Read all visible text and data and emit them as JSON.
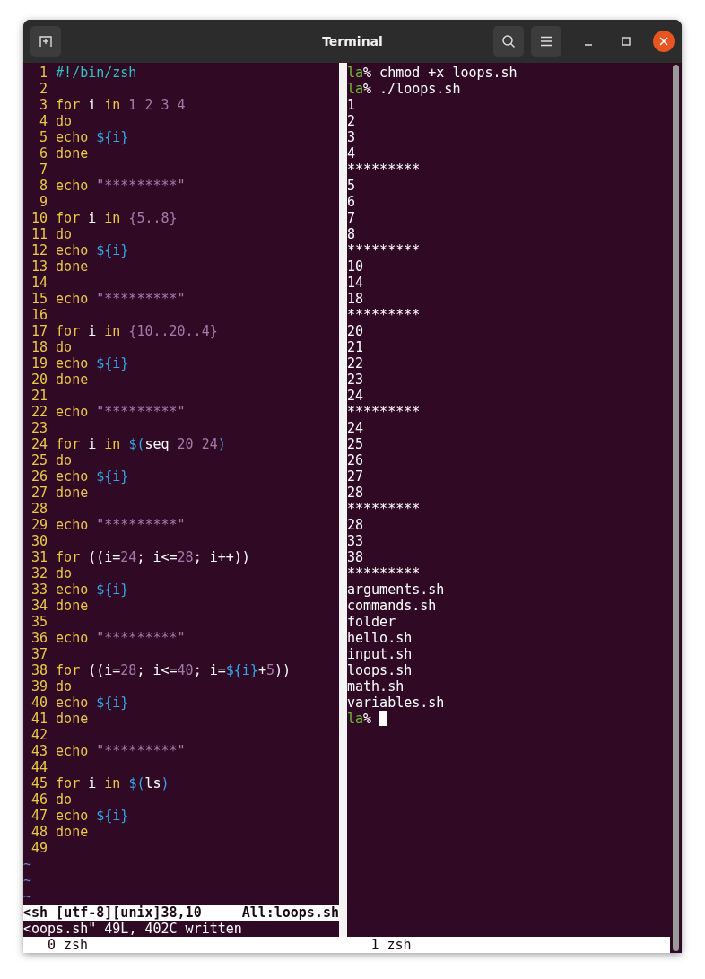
{
  "window": {
    "title": "Terminal"
  },
  "editor": {
    "lines": [
      {
        "number": "1",
        "tokens": [
          {
            "kind": "shebang",
            "text": "#!/bin/zsh"
          }
        ]
      },
      {
        "number": "2"
      },
      {
        "number": "3",
        "tokens": [
          {
            "kind": "keyword",
            "text": "for"
          },
          {
            "kind": "plain",
            "text": " i "
          },
          {
            "kind": "keyword",
            "text": "in"
          },
          {
            "kind": "number",
            "text": " 1 2 3 4"
          }
        ]
      },
      {
        "number": "4",
        "tokens": [
          {
            "kind": "keyword",
            "text": "do"
          }
        ]
      },
      {
        "number": "5",
        "tokens": [
          {
            "kind": "keyword",
            "text": "echo "
          },
          {
            "kind": "variable",
            "text": "${i}"
          }
        ]
      },
      {
        "number": "6",
        "tokens": [
          {
            "kind": "keyword",
            "text": "done"
          }
        ]
      },
      {
        "number": "7"
      },
      {
        "number": "8",
        "tokens": [
          {
            "kind": "keyword",
            "text": "echo "
          },
          {
            "kind": "string",
            "text": "\"*********\""
          }
        ]
      },
      {
        "number": "9"
      },
      {
        "number": "10",
        "tokens": [
          {
            "kind": "keyword",
            "text": "for"
          },
          {
            "kind": "plain",
            "text": " i "
          },
          {
            "kind": "keyword",
            "text": "in "
          },
          {
            "kind": "number",
            "text": "{5..8}"
          }
        ]
      },
      {
        "number": "11",
        "tokens": [
          {
            "kind": "keyword",
            "text": "do"
          }
        ]
      },
      {
        "number": "12",
        "tokens": [
          {
            "kind": "keyword",
            "text": "echo "
          },
          {
            "kind": "variable",
            "text": "${i}"
          }
        ]
      },
      {
        "number": "13",
        "tokens": [
          {
            "kind": "keyword",
            "text": "done"
          }
        ]
      },
      {
        "number": "14"
      },
      {
        "number": "15",
        "tokens": [
          {
            "kind": "keyword",
            "text": "echo "
          },
          {
            "kind": "string",
            "text": "\"*********\""
          }
        ]
      },
      {
        "number": "16"
      },
      {
        "number": "17",
        "tokens": [
          {
            "kind": "keyword",
            "text": "for"
          },
          {
            "kind": "plain",
            "text": " i "
          },
          {
            "kind": "keyword",
            "text": "in "
          },
          {
            "kind": "number",
            "text": "{10..20..4}"
          }
        ]
      },
      {
        "number": "18",
        "tokens": [
          {
            "kind": "keyword",
            "text": "do"
          }
        ]
      },
      {
        "number": "19",
        "tokens": [
          {
            "kind": "keyword",
            "text": "echo "
          },
          {
            "kind": "variable",
            "text": "${i}"
          }
        ]
      },
      {
        "number": "20",
        "tokens": [
          {
            "kind": "keyword",
            "text": "done"
          }
        ]
      },
      {
        "number": "21"
      },
      {
        "number": "22",
        "tokens": [
          {
            "kind": "keyword",
            "text": "echo "
          },
          {
            "kind": "string",
            "text": "\"*********\""
          }
        ]
      },
      {
        "number": "23"
      },
      {
        "number": "24",
        "tokens": [
          {
            "kind": "keyword",
            "text": "for"
          },
          {
            "kind": "plain",
            "text": " i "
          },
          {
            "kind": "keyword",
            "text": "in "
          },
          {
            "kind": "variable",
            "text": "$("
          },
          {
            "kind": "plain",
            "text": "seq "
          },
          {
            "kind": "number",
            "text": "20 24"
          },
          {
            "kind": "variable",
            "text": ")"
          }
        ]
      },
      {
        "number": "25",
        "tokens": [
          {
            "kind": "keyword",
            "text": "do"
          }
        ]
      },
      {
        "number": "26",
        "tokens": [
          {
            "kind": "keyword",
            "text": "echo "
          },
          {
            "kind": "variable",
            "text": "${i}"
          }
        ]
      },
      {
        "number": "27",
        "tokens": [
          {
            "kind": "keyword",
            "text": "done"
          }
        ]
      },
      {
        "number": "28"
      },
      {
        "number": "29",
        "tokens": [
          {
            "kind": "keyword",
            "text": "echo "
          },
          {
            "kind": "string",
            "text": "\"*********\""
          }
        ]
      },
      {
        "number": "30"
      },
      {
        "number": "31",
        "tokens": [
          {
            "kind": "keyword",
            "text": "for"
          },
          {
            "kind": "plain",
            "text": " ((i="
          },
          {
            "kind": "number",
            "text": "24"
          },
          {
            "kind": "plain",
            "text": "; i<="
          },
          {
            "kind": "number",
            "text": "28"
          },
          {
            "kind": "plain",
            "text": "; i++))"
          }
        ]
      },
      {
        "number": "32",
        "tokens": [
          {
            "kind": "keyword",
            "text": "do"
          }
        ]
      },
      {
        "number": "33",
        "tokens": [
          {
            "kind": "keyword",
            "text": "echo "
          },
          {
            "kind": "variable",
            "text": "${i}"
          }
        ]
      },
      {
        "number": "34",
        "tokens": [
          {
            "kind": "keyword",
            "text": "done"
          }
        ]
      },
      {
        "number": "35"
      },
      {
        "number": "36",
        "tokens": [
          {
            "kind": "keyword",
            "text": "echo "
          },
          {
            "kind": "string",
            "text": "\"*********\""
          }
        ]
      },
      {
        "number": "37"
      },
      {
        "number": "38",
        "tokens": [
          {
            "kind": "keyword",
            "text": "for"
          },
          {
            "kind": "plain",
            "text": " ((i="
          },
          {
            "kind": "number",
            "text": "28"
          },
          {
            "kind": "plain",
            "text": "; i<="
          },
          {
            "kind": "number",
            "text": "40"
          },
          {
            "kind": "plain",
            "text": "; i="
          },
          {
            "kind": "variable",
            "text": "${i}"
          },
          {
            "kind": "plain",
            "text": "+"
          },
          {
            "kind": "number",
            "text": "5"
          },
          {
            "kind": "plain",
            "text": "))"
          }
        ]
      },
      {
        "number": "39",
        "tokens": [
          {
            "kind": "keyword",
            "text": "do"
          }
        ]
      },
      {
        "number": "40",
        "tokens": [
          {
            "kind": "keyword",
            "text": "echo "
          },
          {
            "kind": "variable",
            "text": "${i}"
          }
        ]
      },
      {
        "number": "41",
        "tokens": [
          {
            "kind": "keyword",
            "text": "done"
          }
        ]
      },
      {
        "number": "42"
      },
      {
        "number": "43",
        "tokens": [
          {
            "kind": "keyword",
            "text": "echo "
          },
          {
            "kind": "string",
            "text": "\"*********\""
          }
        ]
      },
      {
        "number": "44"
      },
      {
        "number": "45",
        "tokens": [
          {
            "kind": "keyword",
            "text": "for"
          },
          {
            "kind": "plain",
            "text": " i "
          },
          {
            "kind": "keyword",
            "text": "in "
          },
          {
            "kind": "variable",
            "text": "$("
          },
          {
            "kind": "plain",
            "text": "ls"
          },
          {
            "kind": "variable",
            "text": ")"
          }
        ]
      },
      {
        "number": "46",
        "tokens": [
          {
            "kind": "keyword",
            "text": "do"
          }
        ]
      },
      {
        "number": "47",
        "tokens": [
          {
            "kind": "keyword",
            "text": "echo "
          },
          {
            "kind": "variable",
            "text": "${i}"
          }
        ]
      },
      {
        "number": "48",
        "tokens": [
          {
            "kind": "keyword",
            "text": "done"
          }
        ]
      },
      {
        "number": "49"
      }
    ],
    "tildes": [
      "~",
      "~",
      "~"
    ],
    "status_line": {
      "left": "<sh [utf-8][unix]38,10",
      "right": "All:loops.sh"
    },
    "message": "<oops.sh\" 49L, 402C written"
  },
  "shell": {
    "lines": [
      {
        "kind": "prompt",
        "user": "la",
        "symbol": "%",
        "command": "chmod +x loops.sh"
      },
      {
        "kind": "prompt",
        "user": "la",
        "symbol": "%",
        "command": "./loops.sh"
      },
      {
        "kind": "output",
        "text": "1"
      },
      {
        "kind": "output",
        "text": "2"
      },
      {
        "kind": "output",
        "text": "3"
      },
      {
        "kind": "output",
        "text": "4"
      },
      {
        "kind": "output",
        "text": "*********"
      },
      {
        "kind": "output",
        "text": "5"
      },
      {
        "kind": "output",
        "text": "6"
      },
      {
        "kind": "output",
        "text": "7"
      },
      {
        "kind": "output",
        "text": "8"
      },
      {
        "kind": "output",
        "text": "*********"
      },
      {
        "kind": "output",
        "text": "10"
      },
      {
        "kind": "output",
        "text": "14"
      },
      {
        "kind": "output",
        "text": "18"
      },
      {
        "kind": "output",
        "text": "*********"
      },
      {
        "kind": "output",
        "text": "20"
      },
      {
        "kind": "output",
        "text": "21"
      },
      {
        "kind": "output",
        "text": "22"
      },
      {
        "kind": "output",
        "text": "23"
      },
      {
        "kind": "output",
        "text": "24"
      },
      {
        "kind": "output",
        "text": "*********"
      },
      {
        "kind": "output",
        "text": "24"
      },
      {
        "kind": "output",
        "text": "25"
      },
      {
        "kind": "output",
        "text": "26"
      },
      {
        "kind": "output",
        "text": "27"
      },
      {
        "kind": "output",
        "text": "28"
      },
      {
        "kind": "output",
        "text": "*********"
      },
      {
        "kind": "output",
        "text": "28"
      },
      {
        "kind": "output",
        "text": "33"
      },
      {
        "kind": "output",
        "text": "38"
      },
      {
        "kind": "output",
        "text": "*********"
      },
      {
        "kind": "output",
        "text": "arguments.sh"
      },
      {
        "kind": "output",
        "text": "commands.sh"
      },
      {
        "kind": "output",
        "text": "folder"
      },
      {
        "kind": "output",
        "text": "hello.sh"
      },
      {
        "kind": "output",
        "text": "input.sh"
      },
      {
        "kind": "output",
        "text": "loops.sh"
      },
      {
        "kind": "output",
        "text": "math.sh"
      },
      {
        "kind": "output",
        "text": "variables.sh"
      },
      {
        "kind": "prompt",
        "user": "la",
        "symbol": "%",
        "cursor": true
      }
    ]
  },
  "tmux": {
    "windows": [
      "0 zsh",
      "1 zsh"
    ]
  }
}
